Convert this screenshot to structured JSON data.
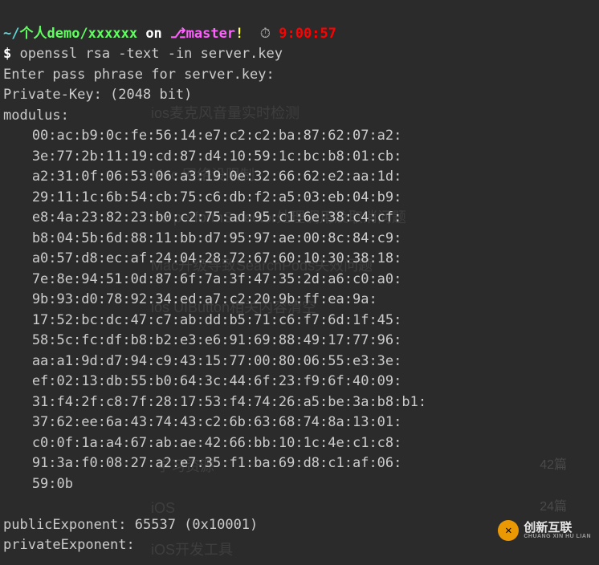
{
  "prompt": {
    "path_prefix": "~/",
    "path_main": "个人demo/xxxxxx",
    "on": " on ",
    "branch_icon": "⎇",
    "branch": "master",
    "dirty": "!",
    "clock_icon": "⏱",
    "time": " 9:00:57"
  },
  "command": {
    "symbol": "$ ",
    "text": "openssl rsa -text -in server.key"
  },
  "output": {
    "enter_pass": "Enter pass phrase for server.key:",
    "private_key": "Private-Key: (2048 bit)",
    "modulus_label": "modulus:",
    "modulus_lines": [
      "00:ac:b9:0c:fe:56:14:e7:c2:c2:ba:87:62:07:a2:",
      "3e:77:2b:11:19:cd:87:d4:10:59:1c:bc:b8:01:cb:",
      "a2:31:0f:06:53:06:a3:19:0e:32:66:62:e2:aa:1d:",
      "29:11:1c:6b:54:cb:75:c6:db:f2:a5:03:eb:04:b9:",
      "e8:4a:23:82:23:b0:c2:75:ad:95:c1:6e:38:c4:cf:",
      "b8:04:5b:6d:88:11:bb:d7:95:97:ae:00:8c:84:c9:",
      "a0:57:d8:ec:af:24:04:28:72:67:60:10:30:38:18:",
      "7e:8e:94:51:0d:87:6f:7a:3f:47:35:2d:a6:c0:a0:",
      "9b:93:d0:78:92:34:ed:a7:c2:20:9b:ff:ea:9a:",
      "17:52:bc:dc:47:c7:ab:dd:b5:71:c6:f7:6d:1f:45:",
      "58:5c:fc:df:b8:b2:e3:e6:91:69:88:49:17:77:96:",
      "aa:a1:9d:d7:94:c9:43:15:77:00:80:06:55:e3:3e:",
      "ef:02:13:db:55:b0:64:3c:44:6f:23:f9:6f:40:09:",
      "31:f4:2f:c8:7f:28:17:53:f4:74:26:a5:be:3a:b8:b1:",
      "37:62:ee:6a:43:74:43:c2:6b:63:68:74:8a:13:01:",
      "c0:0f:1a:a4:67:ab:ae:42:66:bb:10:1c:4e:c1:c8:",
      "91:3a:f0:08:27:a2:e7:35:f1:ba:69:d8:c1:af:06:",
      "59:0b"
    ],
    "public_exponent": "publicExponent: 65537 (0x10001)",
    "private_exponent": "privateExponent:"
  },
  "ghost": {
    "g1": "ios麦克风音量实时检测",
    "g2": "Mac 网络设限制",
    "g3": "ios performSelector处理调用及取消问题",
    "g4": "Mac升级导致SearchPods失效问题",
    "g5": "ios UIButton相关内容清空",
    "g6": "学习资源",
    "g6a": "42篇",
    "g7": "iOS",
    "g7a": "24篇",
    "g8": "iOS开发工具"
  },
  "watermark": {
    "main": "创新互联",
    "sub": "CHUANG XIN HU LIAN"
  }
}
